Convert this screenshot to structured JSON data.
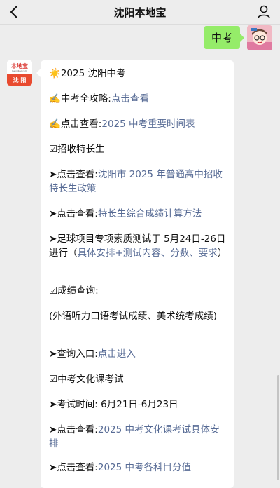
{
  "header": {
    "title": "沈阳本地宝"
  },
  "user_message": {
    "text": "中考"
  },
  "bot_avatar": {
    "brand": "本地宝",
    "url": "bendibao.com",
    "city": "沈 阳"
  },
  "message": {
    "l01": "2025 沈阳中考",
    "l02_prefix": "中考全攻略:",
    "l02_link": "点击查看",
    "l03_prefix": "点击查看:",
    "l03_link": "2025 中考重要时间表",
    "l04": "招收特长生",
    "l05_prefix": "点击查看:",
    "l05_link": "沈阳市 2025 年普通高中招收特长生政策",
    "l06_prefix": "点击查看:",
    "l06_link": "特长生综合成绩计算方法",
    "l07_prefix": "足球项目专项素质测试于 5月24日-26日进行（",
    "l07_link": "具体安排+测试内容、分数、要求",
    "l07_suffix": "）",
    "l08": "成绩查询:",
    "l09": "(外语听力口语考试成绩、美术统考成绩)",
    "l10_prefix": "查询入口:",
    "l10_link": "点击进入",
    "l11": "中考文化课考试",
    "l12": "考试时间: 6月21日-6月23日",
    "l13_prefix": "点击查看:",
    "l13_link": "2025 中考文化课考试具体安排",
    "l14_prefix": "点击查看:",
    "l14_link": "2025 中考各科目分值"
  },
  "icons": {
    "back": "chevron-left-icon",
    "profile": "person-icon",
    "sun": "sun-emoji",
    "writing_hand": "writing-hand-emoji",
    "checkbox": "ballot-box-with-check-icon",
    "arrowhead": "black-arrowhead-icon"
  },
  "colors": {
    "background": "#ededed",
    "user_bubble": "#95ec69",
    "link": "#576b95",
    "city_red": "#e84a2f"
  }
}
